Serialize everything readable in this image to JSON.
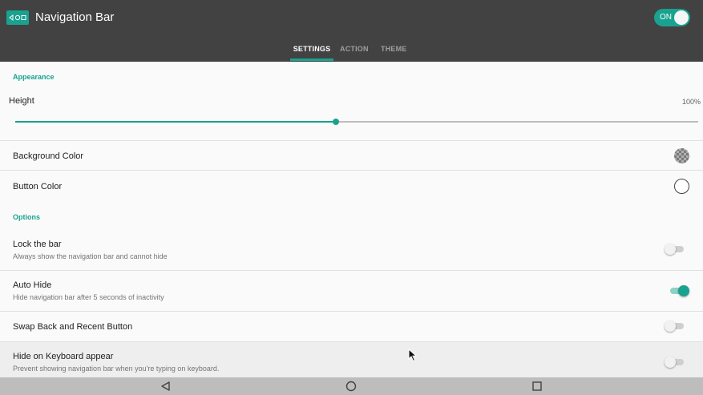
{
  "app": {
    "title": "Navigation Bar",
    "master_switch": "ON"
  },
  "tabs": [
    {
      "label": "SETTINGS",
      "active": true
    },
    {
      "label": "ACTION",
      "active": false
    },
    {
      "label": "THEME",
      "active": false
    }
  ],
  "appearance": {
    "header": "Appearance",
    "height": {
      "label": "Height",
      "value_text": "100%",
      "slider_fraction": 0.47
    },
    "background_color": {
      "label": "Background Color",
      "swatch": "transparent-checker"
    },
    "button_color": {
      "label": "Button Color",
      "swatch": "#ffffff"
    }
  },
  "options": {
    "header": "Options",
    "items": [
      {
        "title": "Lock the bar",
        "subtitle": "Always show the navigation bar and cannot hide",
        "enabled": false
      },
      {
        "title": "Auto Hide",
        "subtitle": "Hide navigation bar after 5 seconds of inactivity",
        "enabled": true
      },
      {
        "title": "Swap Back and Recent Button",
        "subtitle": "",
        "enabled": false
      },
      {
        "title": "Hide on Keyboard appear",
        "subtitle": "Prevent showing navigation bar when you're typing on keyboard.",
        "enabled": false
      }
    ]
  },
  "system_nav": {
    "buttons": [
      "back-icon",
      "home-icon",
      "recents-icon"
    ]
  },
  "colors": {
    "accent": "#19a28f",
    "appbar": "#424242",
    "background": "#fafafa"
  }
}
